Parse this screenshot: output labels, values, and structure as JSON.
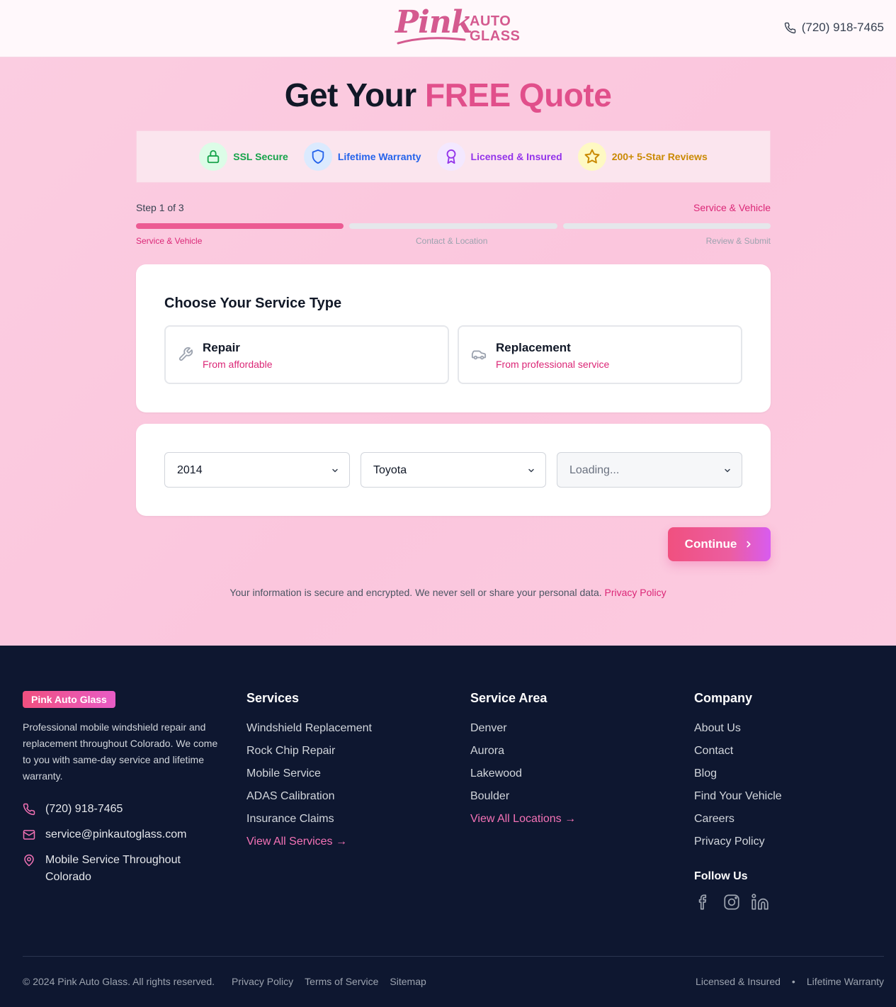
{
  "header": {
    "logo_script": "Pink",
    "logo_line1": "AUTO",
    "logo_line2": "GLASS",
    "phone": "(720) 918-7465"
  },
  "hero": {
    "title_main": "Get Your ",
    "title_accent": "FREE Quote"
  },
  "trust_badges": [
    {
      "label": "SSL Secure",
      "icon": "lock-icon",
      "color": "#16a34a",
      "bg": "#dcfce7"
    },
    {
      "label": "Lifetime Warranty",
      "icon": "shield-icon",
      "color": "#2563eb",
      "bg": "#dbeafe"
    },
    {
      "label": "Licensed & Insured",
      "icon": "award-icon",
      "color": "#9333ea",
      "bg": "#f3e8ff"
    },
    {
      "label": "200+ 5-Star Reviews",
      "icon": "star-icon",
      "color": "#ca8a04",
      "bg": "#fef9c3"
    }
  ],
  "progress": {
    "step_text": "Step 1 of 3",
    "current_label": "Service & Vehicle",
    "steps": [
      "Service & Vehicle",
      "Contact & Location",
      "Review & Submit"
    ],
    "completed_fraction": 0.333
  },
  "service_card": {
    "heading": "Choose Your Service Type",
    "options": [
      {
        "name": "Repair",
        "sub": "From affordable",
        "icon": "wrench-icon"
      },
      {
        "name": "Replacement",
        "sub": "From professional service",
        "icon": "car-icon"
      }
    ]
  },
  "vehicle": {
    "year": "2014",
    "make": "Toyota",
    "model": "Loading..."
  },
  "continue_label": "Continue",
  "privacy": {
    "text": "Your information is secure and encrypted. We never sell or share your personal data. ",
    "link": "Privacy Policy"
  },
  "footer": {
    "badge": "Pink Auto Glass",
    "description": "Professional mobile windshield repair and replacement throughout Colorado. We come to you with same-day service and lifetime warranty.",
    "phone": "(720) 918-7465",
    "email": "service@pinkautoglass.com",
    "location": "Mobile Service Throughout Colorado",
    "services": {
      "heading": "Services",
      "links": [
        "Windshield Replacement",
        "Rock Chip Repair",
        "Mobile Service",
        "ADAS Calibration",
        "Insurance Claims"
      ],
      "more": "View All Services →"
    },
    "area": {
      "heading": "Service Area",
      "links": [
        "Denver",
        "Aurora",
        "Lakewood",
        "Boulder"
      ],
      "more": "View All Locations →"
    },
    "company": {
      "heading": "Company",
      "links": [
        "About Us",
        "Contact",
        "Blog",
        "Find Your Vehicle",
        "Careers",
        "Privacy Policy"
      ]
    },
    "follow": "Follow Us",
    "social": [
      "facebook-icon",
      "instagram-icon",
      "linkedin-icon"
    ],
    "copyright": "© 2024 Pink Auto Glass. All rights reserved.",
    "bottom_links": [
      "Privacy Policy",
      "Terms of Service",
      "Sitemap"
    ],
    "bottom_right": [
      "Licensed & Insured",
      "•",
      "Lifetime Warranty"
    ]
  }
}
